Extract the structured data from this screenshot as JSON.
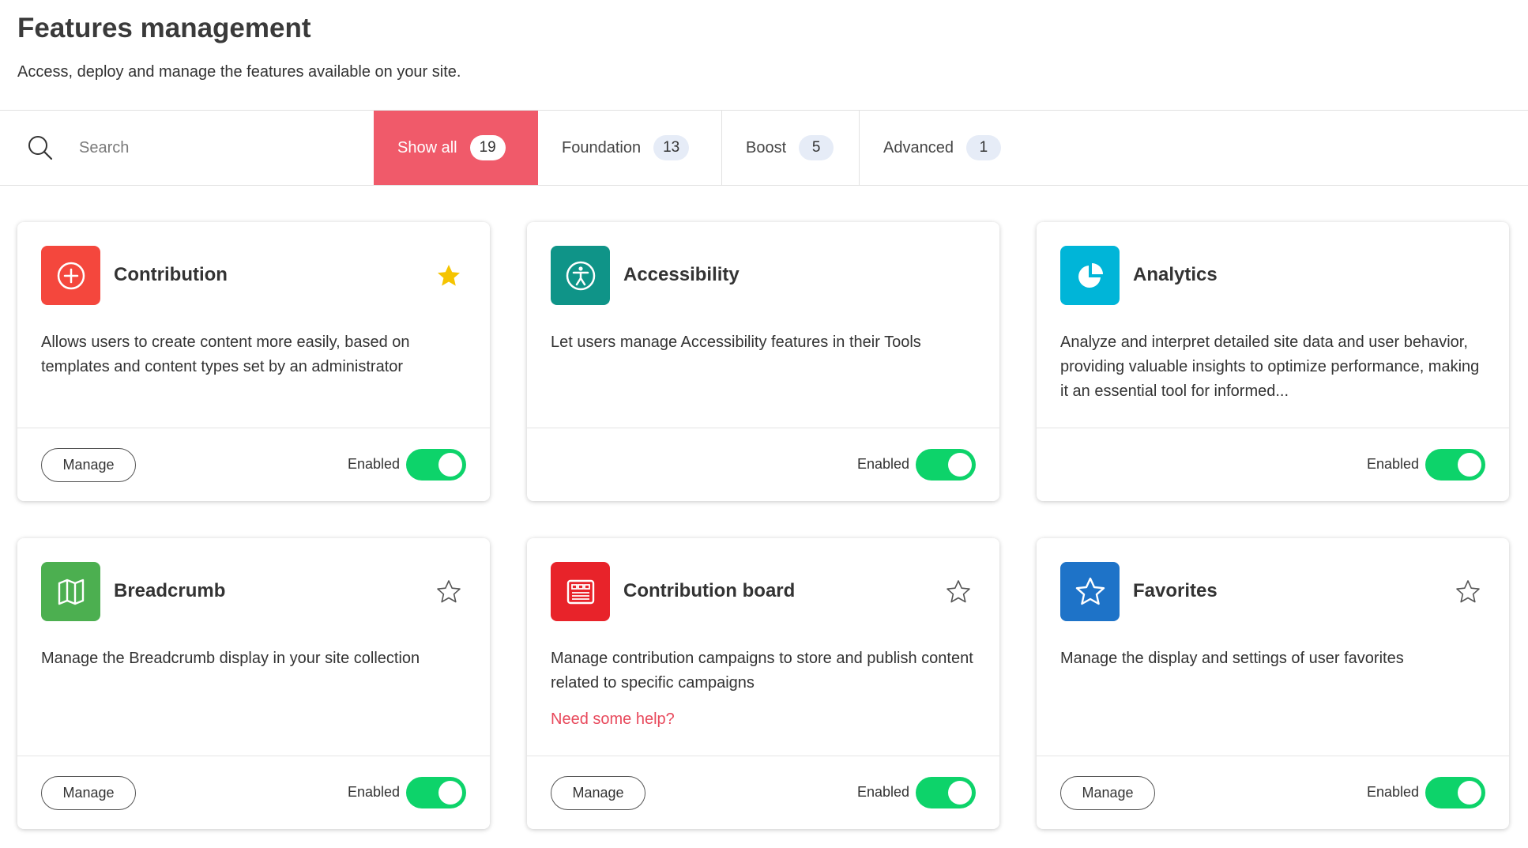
{
  "header": {
    "title": "Features management",
    "subtitle": "Access, deploy and manage the features available on your site."
  },
  "search": {
    "placeholder": "Search",
    "value": ""
  },
  "tabs": [
    {
      "label": "Show all",
      "count": "19",
      "active": true
    },
    {
      "label": "Foundation",
      "count": "13",
      "active": false
    },
    {
      "label": "Boost",
      "count": "5",
      "active": false
    },
    {
      "label": "Advanced",
      "count": "1",
      "active": false
    }
  ],
  "colors": {
    "accent": "#f05a6a",
    "toggle_on": "#0dd36a",
    "link": "#e8495c",
    "star_filled": "#f5c400"
  },
  "cards": [
    {
      "title": "Contribution",
      "description": "Allows users to create content more easily, based on templates and content types set by an administrator",
      "icon": "plus-circle-icon",
      "icon_color": "#f4473d",
      "favorite": true,
      "has_manage": true,
      "manage_label": "Manage",
      "status": "Enabled",
      "enabled": true
    },
    {
      "title": "Accessibility",
      "description": "Let users manage Accessibility features in their Tools",
      "icon": "accessibility-icon",
      "icon_color": "#0f9488",
      "favorite": false,
      "has_manage": false,
      "status": "Enabled",
      "enabled": true
    },
    {
      "title": "Analytics",
      "description": "Analyze and interpret detailed site data and user behavior, providing valuable insights to optimize performance, making it an essential tool for informed...",
      "icon": "pie-chart-icon",
      "icon_color": "#00b5d8",
      "favorite": false,
      "has_manage": false,
      "status": "Enabled",
      "enabled": true
    },
    {
      "title": "Breadcrumb",
      "description": "Manage the Breadcrumb display in your site collection",
      "icon": "map-icon",
      "icon_color": "#4caf50",
      "favorite": false,
      "has_manage": true,
      "manage_label": "Manage",
      "status": "Enabled",
      "enabled": true
    },
    {
      "title": "Contribution board",
      "description": "Manage contribution campaigns to store and publish content related to specific campaigns",
      "link": "Need some help?",
      "icon": "board-icon",
      "icon_color": "#e8232a",
      "favorite": false,
      "has_manage": true,
      "manage_label": "Manage",
      "status": "Enabled",
      "enabled": true
    },
    {
      "title": "Favorites",
      "description": "Manage the display and settings of user favorites",
      "icon": "star-icon",
      "icon_color": "#1e73c8",
      "favorite": false,
      "has_manage": true,
      "manage_label": "Manage",
      "status": "Enabled",
      "enabled": true
    }
  ]
}
